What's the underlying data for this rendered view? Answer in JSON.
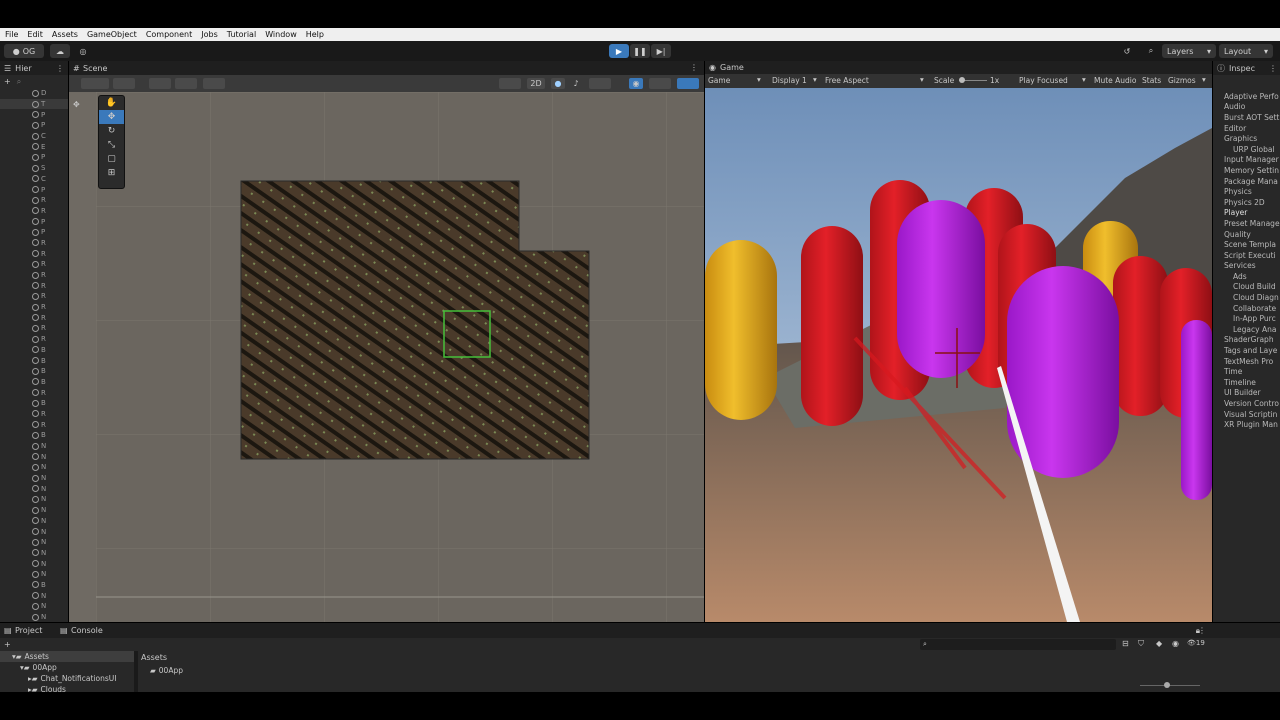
{
  "menu": [
    "File",
    "Edit",
    "Assets",
    "GameObject",
    "Component",
    "Jobs",
    "Tutorial",
    "Window",
    "Help"
  ],
  "toolbar": {
    "account": "OG",
    "layers": "Layers",
    "layout": "Layout"
  },
  "hierarchy": {
    "tab": "Hier",
    "rows": [
      "D",
      "T",
      "P",
      "P",
      "C",
      "E",
      "P",
      "S",
      "C",
      "P",
      "R",
      "R",
      "P",
      "P",
      "R",
      "R",
      "R",
      "R",
      "R",
      "R",
      "R",
      "R",
      "R",
      "R",
      "B",
      "B",
      "B",
      "B",
      "R",
      "B",
      "R",
      "R",
      "B",
      "N",
      "N",
      "N",
      "N",
      "N",
      "N",
      "N",
      "N",
      "N",
      "N",
      "N",
      "N",
      "N",
      "B",
      "N",
      "N",
      "N",
      "N",
      "N",
      "N",
      "N"
    ]
  },
  "scene": {
    "tab": "Scene",
    "mode_2d": "2D"
  },
  "game": {
    "tab": "Game",
    "view": "Game",
    "display": "Display 1",
    "aspect": "Free Aspect",
    "scale_label": "Scale",
    "scale_value": "1x",
    "play_focused": "Play Focused",
    "mute": "Mute Audio",
    "stats": "Stats",
    "gizmos": "Gizmos"
  },
  "inspector": {
    "tab": "Inspec",
    "items": [
      "Adaptive Perfo",
      "Audio",
      "Burst AOT Sett",
      "Editor",
      "Graphics",
      "URP Global",
      "Input Manager",
      "Memory Settin",
      "Package Mana",
      "Physics",
      "Physics 2D",
      "Player",
      "Preset Manage",
      "Quality",
      "Scene Templa",
      "Script Executi",
      "Services",
      "Ads",
      "Cloud Build",
      "Cloud Diagn",
      "Collaborate",
      "In-App Purc",
      "Legacy Ana",
      "ShaderGraph",
      "Tags and Laye",
      "TextMesh Pro",
      "Time",
      "Timeline",
      "UI Builder",
      "Version Contro",
      "Visual Scriptin",
      "XR Plugin Man"
    ]
  },
  "bottom": {
    "tabs": [
      "Project",
      "Console"
    ],
    "tree": [
      "Assets",
      "00App",
      "Chat_NotificationsUI",
      "Clouds"
    ],
    "breadcrumb": "Assets",
    "folder": "00App",
    "count": "19"
  },
  "colors": {
    "accent": "#3a79bb",
    "capsule_red": "#d8191f",
    "capsule_purple": "#b01fe0",
    "capsule_yellow": "#e8b21c"
  }
}
